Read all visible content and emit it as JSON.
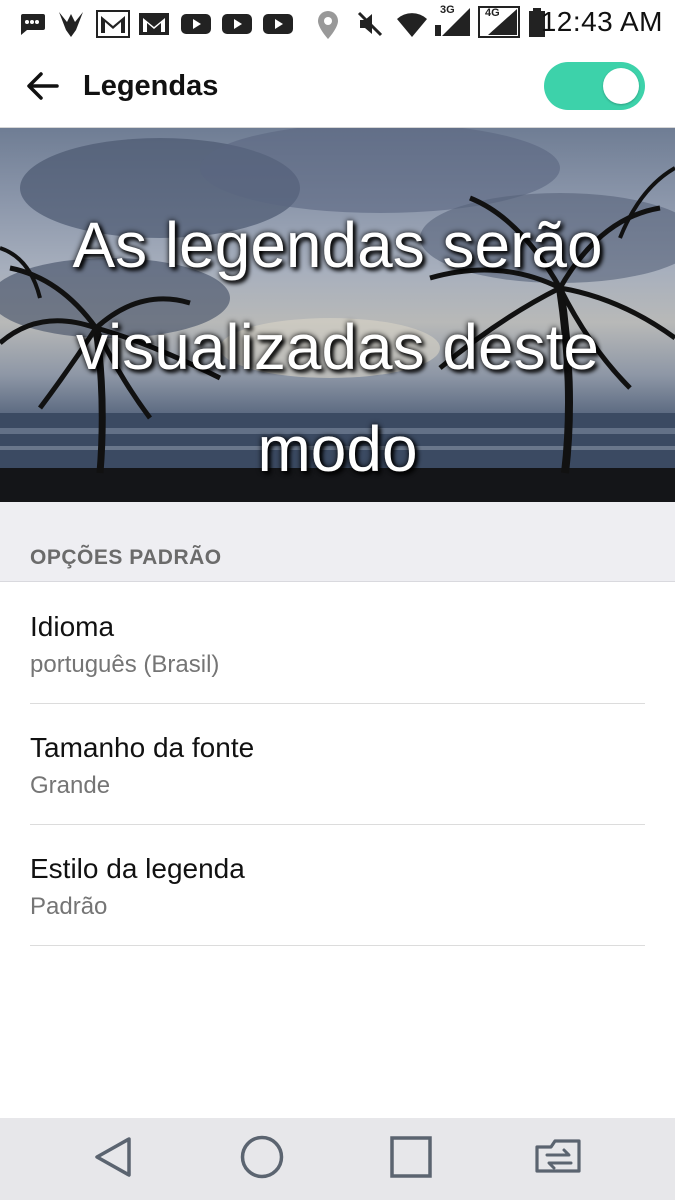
{
  "status_bar": {
    "time": "12:43 AM",
    "network_1": "3G",
    "network_2": "4G",
    "icons": [
      "message-icon",
      "bird-icon",
      "gmail-icon",
      "gmail-icon",
      "youtube-icon",
      "youtube-icon",
      "youtube-icon",
      "location-icon",
      "mute-icon",
      "wifi-icon",
      "signal-icon",
      "signal-icon",
      "battery-icon"
    ]
  },
  "app_bar": {
    "title": "Legendas",
    "toggle_on": true,
    "toggle_color": "#3dd2aa"
  },
  "preview": {
    "caption": "As legendas serão visualizadas deste modo"
  },
  "section": {
    "header": "OPÇÕES PADRÃO"
  },
  "items": [
    {
      "title": "Idioma",
      "subtitle": "português (Brasil)"
    },
    {
      "title": "Tamanho da fonte",
      "subtitle": "Grande"
    },
    {
      "title": "Estilo da legenda",
      "subtitle": "Padrão"
    }
  ],
  "nav_bar": {
    "buttons": [
      "back-triangle-icon",
      "home-circle-icon",
      "recents-square-icon",
      "dual-window-icon"
    ]
  }
}
